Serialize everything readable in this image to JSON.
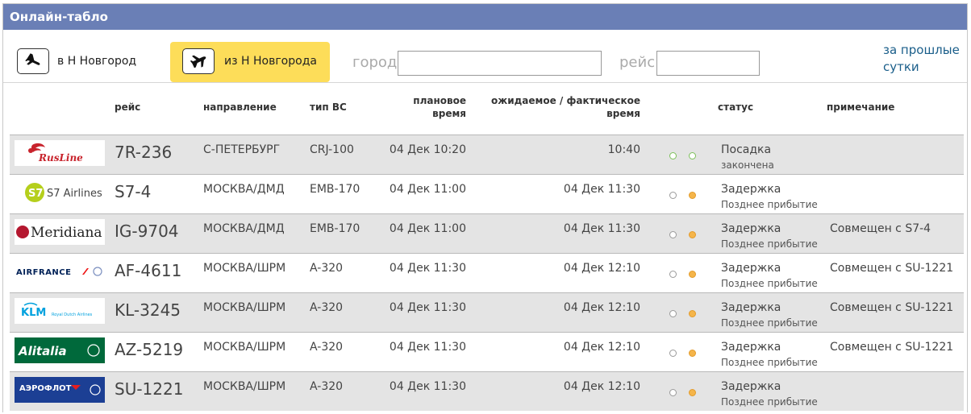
{
  "header": {
    "title": "Онлайн-табло"
  },
  "toolbar": {
    "tab_arrivals": "в Н Новгород",
    "tab_departures": "из Н Новгорода",
    "city_label": "город",
    "city_value": "",
    "flight_label": "рейс",
    "flight_value": "",
    "past_day_link": "за прошлые сутки"
  },
  "columns": {
    "flight": "рейс",
    "direction": "направление",
    "aircraft": "тип ВС",
    "planned_1": "плановое",
    "planned_2": "время",
    "expected_1": "ожидаемое / фактическое",
    "expected_2": "время",
    "status": "статус",
    "note": "примечание"
  },
  "colors": {
    "title_bar": "#6a7fb6",
    "active_tab": "#fddd59",
    "row_gray": "#e4e4e4",
    "dot_green": "#7cc05a",
    "dot_orange": "#f5b54a",
    "link": "#1a5e8a"
  },
  "flights": [
    {
      "logo": "rusline-logo",
      "logo_text": "RusLine",
      "flight": "7R-236",
      "direction": "С-ПЕТЕРБУРГ",
      "aircraft": "CRJ-100",
      "planned": "04 Дек 10:20",
      "expected": "10:40",
      "dots": [
        "green",
        "green"
      ],
      "status": "Посадка",
      "status_sub": "закончена",
      "note": ""
    },
    {
      "logo": "s7-airlines-logo",
      "logo_text": "S7 Airlines",
      "flight": "S7-4",
      "direction": "МОСКВА/ДМД",
      "aircraft": "EMB-170",
      "planned": "04 Дек 11:00",
      "expected": "04 Дек 11:30",
      "dots": [
        "empty",
        "orange"
      ],
      "status": "Задержка",
      "status_sub": "Позднее прибытие",
      "note": ""
    },
    {
      "logo": "meridiana-logo",
      "logo_text": "Meridiana",
      "flight": "IG-9704",
      "direction": "МОСКВА/ДМД",
      "aircraft": "EMB-170",
      "planned": "04 Дек 11:00",
      "expected": "04 Дек 11:30",
      "dots": [
        "empty",
        "orange"
      ],
      "status": "Задержка",
      "status_sub": "Позднее прибытие",
      "note": "Совмещен с S7-4"
    },
    {
      "logo": "airfrance-logo",
      "logo_text": "AIRFRANCE",
      "flight": "AF-4611",
      "direction": "МОСКВА/ШРМ",
      "aircraft": "A-320",
      "planned": "04 Дек 11:30",
      "expected": "04 Дек 12:10",
      "dots": [
        "empty",
        "orange"
      ],
      "status": "Задержка",
      "status_sub": "Позднее прибытие",
      "note": "Совмещен с SU-1221"
    },
    {
      "logo": "klm-logo",
      "logo_text": "KLM",
      "flight": "KL-3245",
      "direction": "МОСКВА/ШРМ",
      "aircraft": "A-320",
      "planned": "04 Дек 11:30",
      "expected": "04 Дек 12:10",
      "dots": [
        "empty",
        "orange"
      ],
      "status": "Задержка",
      "status_sub": "Позднее прибытие",
      "note": "Совмещен с SU-1221"
    },
    {
      "logo": "alitalia-logo",
      "logo_text": "Alitalia",
      "flight": "AZ-5219",
      "direction": "МОСКВА/ШРМ",
      "aircraft": "A-320",
      "planned": "04 Дек 11:30",
      "expected": "04 Дек 12:10",
      "dots": [
        "empty",
        "orange"
      ],
      "status": "Задержка",
      "status_sub": "Позднее прибытие",
      "note": "Совмещен с SU-1221"
    },
    {
      "logo": "aeroflot-logo",
      "logo_text": "АЭРОФЛОТ",
      "flight": "SU-1221",
      "direction": "МОСКВА/ШРМ",
      "aircraft": "A-320",
      "planned": "04 Дек 11:30",
      "expected": "04 Дек 12:10",
      "dots": [
        "empty",
        "orange"
      ],
      "status": "Задержка",
      "status_sub": "Позднее прибытие",
      "note": ""
    }
  ]
}
